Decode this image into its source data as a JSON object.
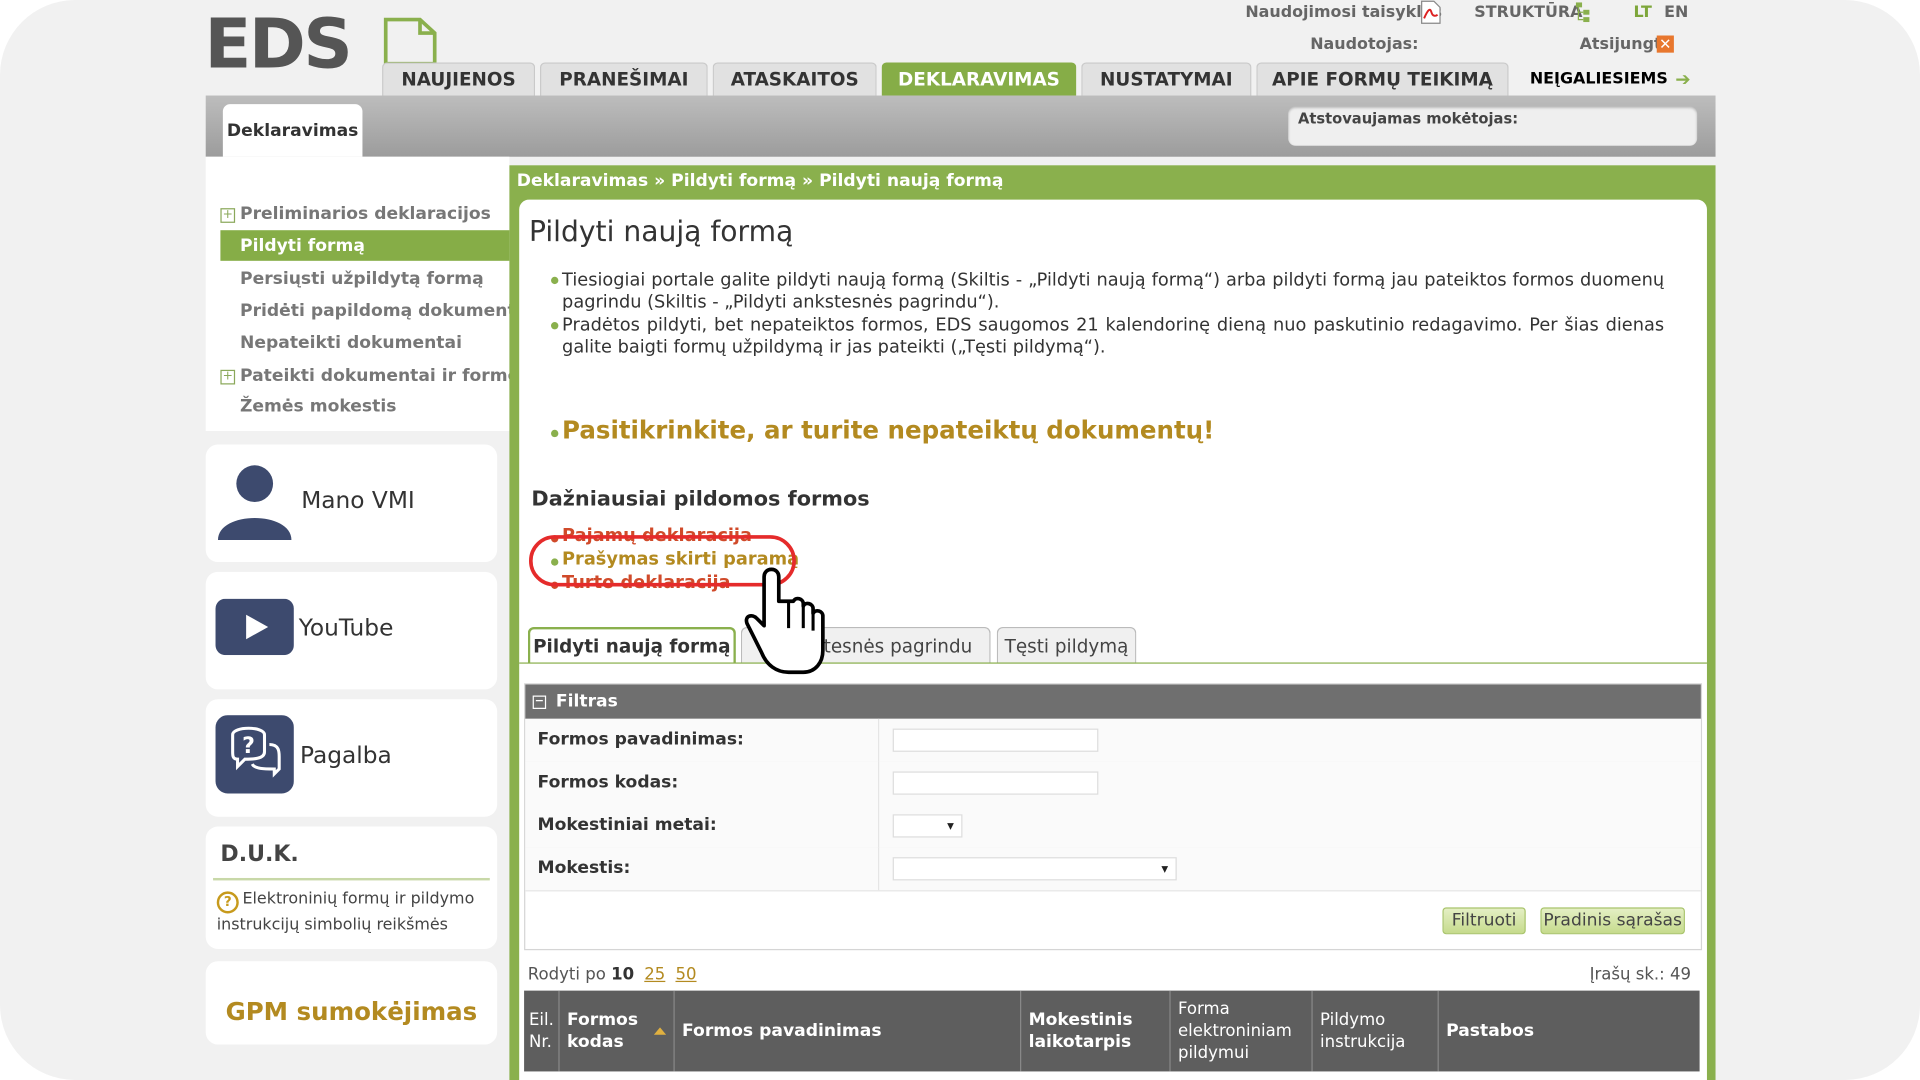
{
  "header": {
    "logo_text": "EDS",
    "usage_rules": "Naudojimosi taisyklės",
    "structure": "STRUKTŪRA",
    "lang_lt": "LT",
    "lang_en": "EN",
    "user_label": "Naudotojas:",
    "logout": "Atsijungti",
    "tabs": [
      "NAUJIENOS",
      "PRANEŠIMAI",
      "ATASKAITOS",
      "DEKLARAVIMAS",
      "NUSTATYMAI",
      "APIE FORMŲ TEIKIMĄ"
    ],
    "active_tab": "DEKLARAVIMAS",
    "disabled_link": "NEĮGALIESIEMS",
    "subtab": "Deklaravimas",
    "represented_payer_label": "Atstovaujamas mokėtojas:"
  },
  "sidebar": {
    "items": [
      {
        "label": "Preliminarios deklaracijos",
        "expandable": true
      },
      {
        "label": "Pildyti formą",
        "active": true
      },
      {
        "label": "Persiųsti užpildytą formą"
      },
      {
        "label": "Pridėti papildomą dokumentą"
      },
      {
        "label": "Nepateikti dokumentai"
      },
      {
        "label": "Pateikti dokumentai ir formos",
        "expandable": true
      },
      {
        "label": "Žemės mokestis"
      }
    ],
    "cards": {
      "mano_vmi": "Mano VMI",
      "youtube": "YouTube",
      "pagalba": "Pagalba",
      "duk_title": "D.U.K.",
      "duk_link": "Elektroninių formų ir pildymo instrukcijų simbolių reikšmės",
      "gpm": "GPM sumokėjimas"
    }
  },
  "main": {
    "breadcrumb": "Deklaravimas » Pildyti formą » Pildyti naują formą",
    "title": "Pildyti naują formą",
    "bullets": [
      "Tiesiogiai portale galite pildyti naują formą (Skiltis - „Pildyti naują formą“) arba pildyti formą jau pateiktos formos duomenų pagrindu (Skiltis - „Pildyti ankstesnės pagrindu“).",
      "Pradėtos pildyti, bet nepateiktos formos, EDS saugomos 21 kalendorinę dieną nuo paskutinio redagavimo. Per šias dienas galite baigti formų užpildymą ir jas pateikti („Tęsti pildymą“)."
    ],
    "warning": "Pasitikrinkite, ar turite nepateiktų dokumentų!",
    "frequent_title": "Dažniausiai pildomos formos",
    "frequent_links": [
      "Pajamų deklaracija",
      "Prašymas skirti paramą",
      "Turto deklaracija"
    ],
    "tabs": [
      "Pildyti naują formą",
      "Pildyti ankstesnės pagrindu",
      "Tęsti pildymą"
    ],
    "tab2_visible": "kstesnės pagrindu",
    "filter": {
      "title": "Filtras",
      "rows": [
        {
          "label": "Formos pavadinimas:",
          "type": "input",
          "value": ""
        },
        {
          "label": "Formos kodas:",
          "type": "input",
          "value": ""
        },
        {
          "label": "Mokestiniai metai:",
          "type": "select",
          "value": ""
        },
        {
          "label": "Mokestis:",
          "type": "select",
          "value": ""
        }
      ],
      "btn_filter": "Filtruoti",
      "btn_reset": "Pradinis sąrašas"
    },
    "paging": {
      "label": "Rodyti po",
      "current": "10",
      "options": [
        "25",
        "50"
      ]
    },
    "count": "Įrašų sk.: 49",
    "table_headers": [
      "Eil. Nr.",
      "Formos kodas",
      "Formos pavadinimas",
      "Mokestinis laikotarpis",
      "Forma elektroniniam pildymui",
      "Pildymo instrukcija",
      "Pastabos"
    ]
  },
  "colors": {
    "accent": "#86ad47",
    "gold": "#b38a20",
    "highlight": "#e52b2b"
  }
}
